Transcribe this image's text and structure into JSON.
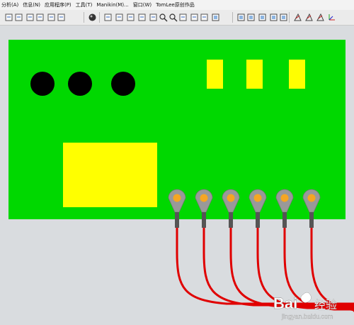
{
  "menu": [
    "分析(A)",
    "信息(N)",
    "应用程序(P)",
    "工具(T)",
    "Manikin(M)...",
    "窗口(W)",
    "TomLee原创作品"
  ],
  "toolbar": {
    "icons": [
      "copy-icon",
      "paste-icon",
      "paste-special-icon",
      "mirror-paste-icon",
      "regenerate-icon",
      "select-box-icon",
      "appearance-sphere-icon",
      "redraw-icon",
      "spin-center-icon",
      "orient-icon",
      "view-manager-icon",
      "pan-icon",
      "zoom-in-icon",
      "zoom-out-icon",
      "refit-icon",
      "reorient-icon",
      "saved-views-icon",
      "layers-icon",
      "display-wireframe-icon",
      "display-hidden-icon",
      "display-no-hidden-icon",
      "display-shaded-icon",
      "display-enhanced-icon",
      "datum-planes-icon",
      "datum-axes-icon",
      "datum-points-icon",
      "coordinate-systems-icon"
    ]
  },
  "model": {
    "board_color": "#00d800",
    "pad_color": "#ffff00",
    "hole_color": "#000000",
    "wire_color": "#e00000",
    "terminal_color": "#999999",
    "terminal_core_color": "#f5a623",
    "holes": 3,
    "small_pads": 3,
    "terminals": 6
  },
  "watermark": {
    "brand": "Bai",
    "brand2": "经验",
    "url": "jingyan.baidu.com"
  }
}
